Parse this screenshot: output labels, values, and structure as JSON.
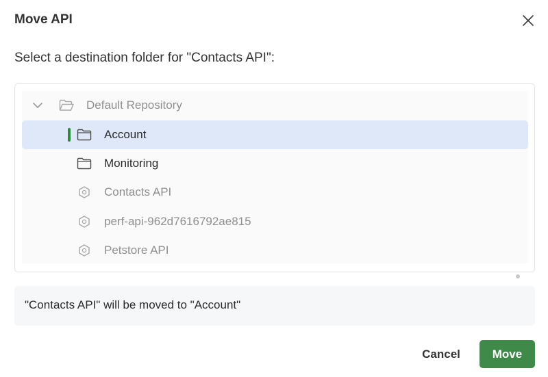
{
  "dialog": {
    "title": "Move API",
    "prompt": "Select a destination folder for \"Contacts API\":",
    "close_icon": "close-icon"
  },
  "tree": {
    "root": {
      "label": "Default Repository",
      "icon": "folder-open-icon",
      "expanded": true
    },
    "items": [
      {
        "label": "Account",
        "icon": "folder-icon",
        "selected": true
      },
      {
        "label": "Monitoring",
        "icon": "folder-icon",
        "selected": false
      },
      {
        "label": "Contacts API",
        "icon": "api-hexagon-icon",
        "selected": false
      },
      {
        "label": "perf-api-962d7616792ae815",
        "icon": "api-hexagon-icon",
        "selected": false
      },
      {
        "label": "Petstore API",
        "icon": "api-hexagon-icon",
        "selected": false
      }
    ]
  },
  "notice": {
    "text": "\"Contacts API\" will be moved to \"Account\""
  },
  "footer": {
    "cancel_label": "Cancel",
    "move_label": "Move"
  },
  "colors": {
    "primary": "#3f8a48",
    "selection": "#dfe8f8",
    "selection_marker": "#2e8b3c"
  }
}
